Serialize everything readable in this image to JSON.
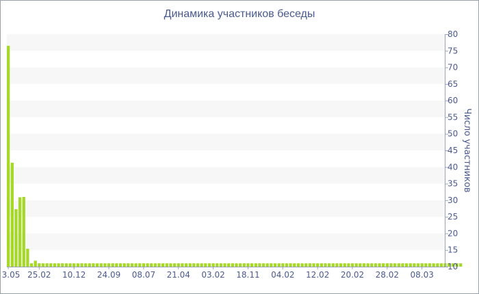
{
  "chart_data": {
    "type": "bar",
    "title": "Динамика участников беседы",
    "xlabel": "",
    "ylabel": "Число участников",
    "ylim": [
      10,
      80
    ],
    "yticks": [
      10,
      15,
      20,
      25,
      30,
      35,
      40,
      45,
      50,
      55,
      60,
      65,
      70,
      75,
      80
    ],
    "y_axis_position": "right",
    "grid": true,
    "bar_color": "#a6d827",
    "x_tick_labels": [
      {
        "label": "3.05",
        "index": 0
      },
      {
        "label": "25.02",
        "index": 8
      },
      {
        "label": "10.12",
        "index": 17
      },
      {
        "label": "24.09",
        "index": 26
      },
      {
        "label": "08.07",
        "index": 35
      },
      {
        "label": "21.04",
        "index": 44
      },
      {
        "label": "03.02",
        "index": 53
      },
      {
        "label": "18.11",
        "index": 62
      },
      {
        "label": "04.02",
        "index": 71
      },
      {
        "label": "12.02",
        "index": 80
      },
      {
        "label": "20.02",
        "index": 89
      },
      {
        "label": "28.02",
        "index": 98
      },
      {
        "label": "08.03",
        "index": 107
      }
    ],
    "values": [
      76.5,
      41.3,
      27.3,
      30.9,
      31.0,
      15.4,
      11.0,
      11.8,
      11.0,
      11.0,
      11.0,
      11.0,
      11.0,
      11.0,
      11.0,
      11.0,
      11.0,
      11.0,
      11.0,
      11.0,
      11.0,
      11.0,
      11.0,
      11.0,
      11.0,
      11.0,
      11.0,
      11.0,
      11.0,
      11.0,
      11.0,
      11.0,
      11.0,
      11.0,
      11.0,
      11.0,
      11.0,
      11.0,
      11.0,
      11.0,
      11.0,
      11.0,
      11.0,
      11.0,
      11.0,
      11.0,
      11.0,
      11.0,
      11.0,
      11.0,
      11.0,
      11.0,
      11.0,
      11.0,
      11.0,
      11.0,
      11.0,
      11.0,
      11.0,
      11.0,
      11.0,
      11.0,
      11.0,
      11.0,
      11.0,
      11.0,
      11.0,
      11.0,
      11.0,
      11.0,
      11.0,
      11.0,
      11.0,
      11.0,
      11.0,
      11.0,
      11.0,
      11.0,
      11.0,
      11.0,
      11.0,
      11.0,
      11.0,
      11.0,
      11.0,
      11.0,
      11.0,
      11.0,
      11.0,
      11.0,
      11.0,
      11.0,
      11.0,
      11.0,
      11.0,
      11.0,
      11.0,
      11.0,
      11.0,
      11.0,
      11.0,
      11.0,
      11.0,
      11.0,
      11.0,
      11.0,
      11.0,
      11.0,
      11.0,
      11.0,
      11.0,
      11.0,
      11.0,
      11.0,
      11.0,
      11.0,
      11.0,
      11.0
    ]
  }
}
